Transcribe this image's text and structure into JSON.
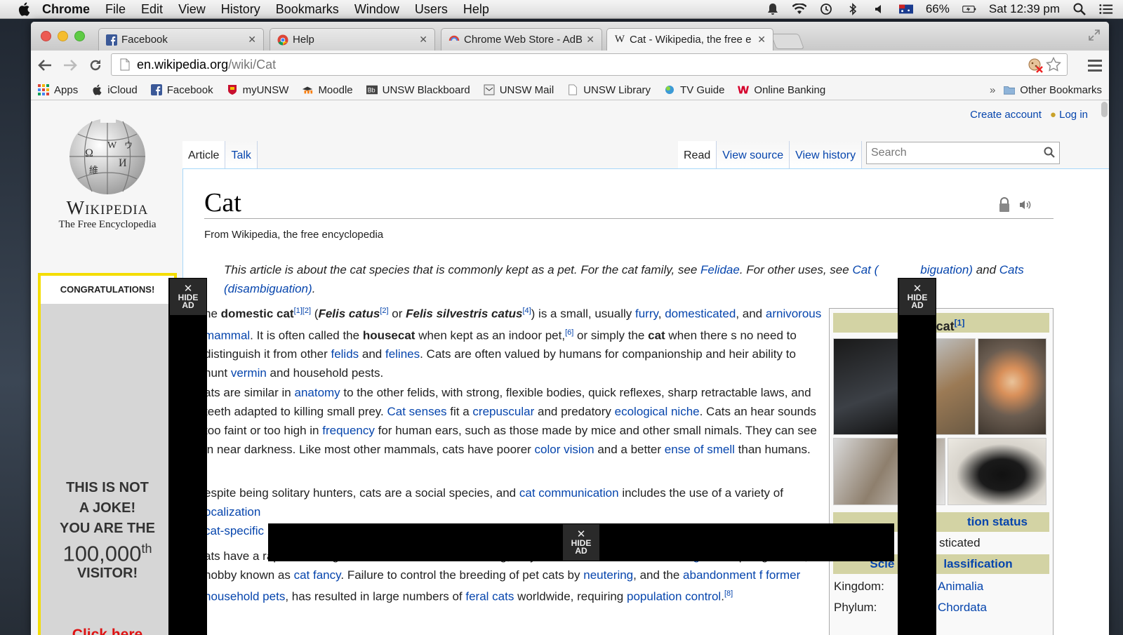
{
  "menubar": {
    "app_name": "Chrome",
    "menus": [
      "File",
      "Edit",
      "View",
      "History",
      "Bookmarks",
      "Window",
      "Users",
      "Help"
    ],
    "battery": "66%",
    "clock": "Sat 12:39 pm"
  },
  "tabs": [
    {
      "title": "Facebook",
      "icon": "facebook-icon"
    },
    {
      "title": "Help",
      "icon": "chrome-icon"
    },
    {
      "title": "Chrome Web Store - AdBlo",
      "icon": "webstore-icon"
    },
    {
      "title": "Cat - Wikipedia, the free e",
      "icon": "wikipedia-icon",
      "active": true
    }
  ],
  "address": {
    "host": "en.wikipedia.org",
    "path": "/wiki/Cat"
  },
  "bookmarks": {
    "items": [
      "Apps",
      "iCloud",
      "Facebook",
      "myUNSW",
      "Moodle",
      "UNSW Blackboard",
      "UNSW Mail",
      "UNSW Library",
      "TV Guide",
      "Online Banking"
    ],
    "overflow": "»",
    "other": "Other Bookmarks"
  },
  "wiki": {
    "wordmark": "Wikipedia",
    "tagline": "The Free Encyclopedia",
    "create_account": "Create account",
    "log_in": "Log in",
    "tab_article": "Article",
    "tab_talk": "Talk",
    "tab_read": "Read",
    "tab_view_source": "View source",
    "tab_view_history": "View history",
    "search_placeholder": "Search",
    "title": "Cat",
    "from": "From Wikipedia, the free encyclopedia",
    "hatnote_1": "This article is about the cat species that is commonly kept as a pet. For the cat family, see ",
    "hatnote_felidae": "Felidae",
    "hatnote_2": ". For other uses, see ",
    "hatnote_cat": "Cat (",
    "hatnote_cat_rest": "biguation)",
    "hatnote_3": " and ",
    "hatnote_cats": "Cats",
    "hatnote_disamb": "(disambiguation)",
    "hatnote_end": "."
  },
  "infobox": {
    "title_visible": "tic cat",
    "title_ref": "[1]",
    "conservation_left": "",
    "conservation_right": "tion status",
    "domesticated": "sticated",
    "classification_left": "Scie",
    "classification_right": "lassification",
    "kingdom_label": "Kingdom:",
    "kingdom_value": "Animalia",
    "phylum_label": "Phylum:",
    "phylum_value": "Chordata"
  },
  "ad": {
    "congrats": "CONGRATULATIONS!",
    "line1": "THIS IS NOT",
    "line2": "A JOKE!",
    "line3": "YOU ARE THE",
    "number": "100,000",
    "suffix": "th",
    "line4": "VISITOR!",
    "click": "Click here",
    "hide_label_1": "HIDE",
    "hide_label_2": "AD"
  },
  "colors": {
    "link": "#0645ad",
    "ad_border": "#f4dd00",
    "infobox_header": "#d3d3a4"
  }
}
